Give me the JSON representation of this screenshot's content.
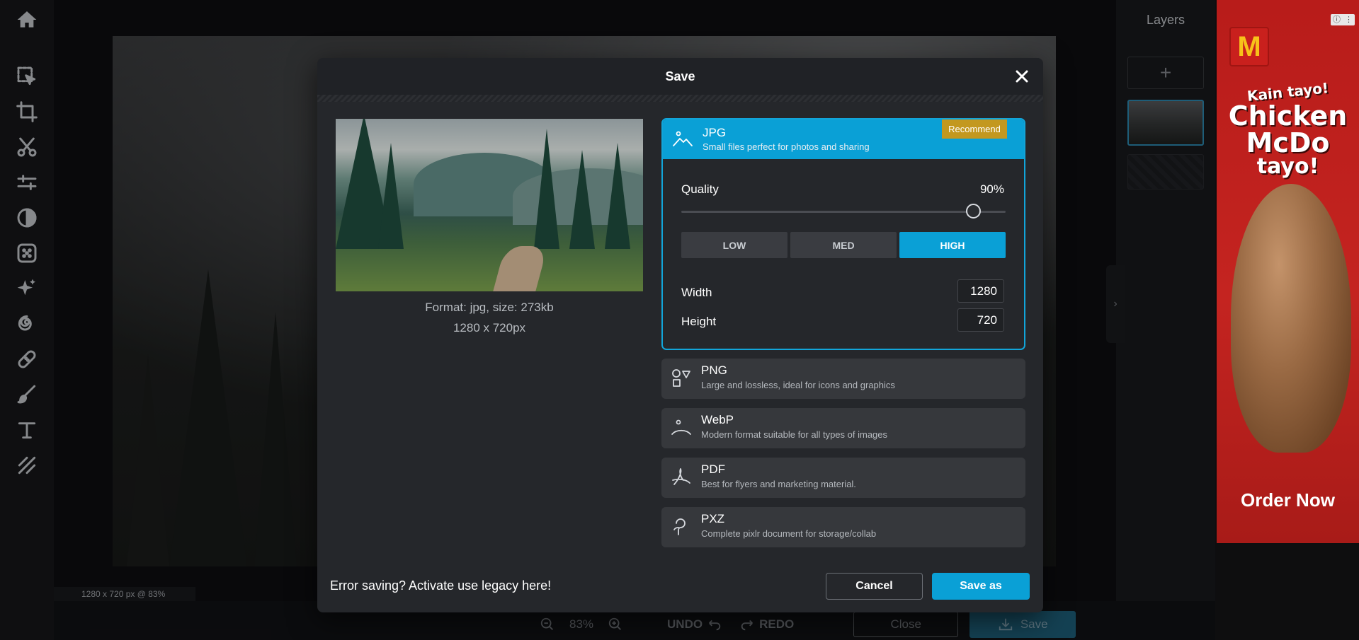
{
  "canvas": {
    "status": "1280 x 720 px @ 83%"
  },
  "bottom_bar": {
    "zoom": "83%",
    "undo": "UNDO",
    "redo": "REDO",
    "close": "Close",
    "save": "Save"
  },
  "layers": {
    "title": "Layers",
    "add": "+"
  },
  "ad": {
    "logo": "M",
    "line1": "Kain tayo!",
    "line2": "Chicken",
    "line3": "McDo",
    "line4": "tayo!",
    "cta": "Order Now"
  },
  "modal": {
    "title": "Save",
    "format_info": "Format: jpg, size: 273kb",
    "dims_info": "1280 x 720px",
    "formats": {
      "jpg": {
        "name": "JPG",
        "desc": "Small files perfect for photos and sharing",
        "badge": "Recommend"
      },
      "png": {
        "name": "PNG",
        "desc": "Large and lossless, ideal for icons and graphics"
      },
      "webp": {
        "name": "WebP",
        "desc": "Modern format suitable for all types of images"
      },
      "pdf": {
        "name": "PDF",
        "desc": "Best for flyers and marketing material."
      },
      "pxz": {
        "name": "PXZ",
        "desc": "Complete pixlr document for storage/collab"
      }
    },
    "quality": {
      "label": "Quality",
      "value": "90%",
      "level": 0.9,
      "presets": [
        "LOW",
        "MED",
        "HIGH"
      ],
      "selected": "HIGH"
    },
    "width": {
      "label": "Width",
      "value": "1280"
    },
    "height": {
      "label": "Height",
      "value": "720"
    },
    "legacy": "Error saving? Activate use legacy here!",
    "cancel": "Cancel",
    "save_as": "Save as"
  },
  "colors": {
    "accent": "#0aa0d6",
    "badge": "#c3981f"
  }
}
